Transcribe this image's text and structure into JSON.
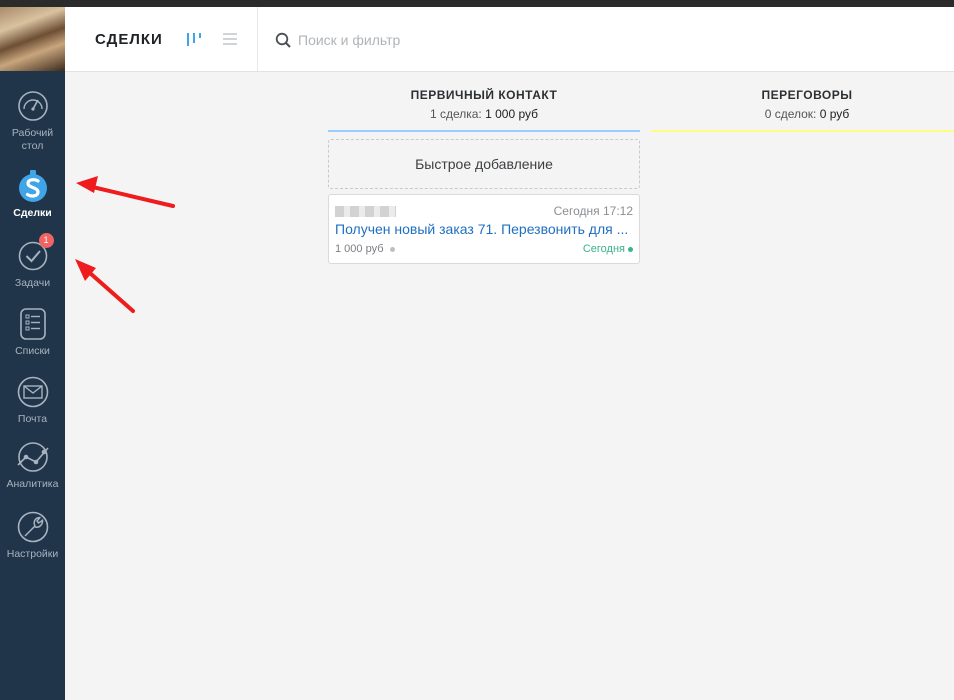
{
  "sidebar": {
    "items": [
      {
        "label": "Рабочий стол",
        "icon": "dashboard-gauge-icon"
      },
      {
        "label": "Сделки",
        "icon": "deals-dollar-icon",
        "active": true
      },
      {
        "label": "Задачи",
        "icon": "tasks-check-icon",
        "badge": "1"
      },
      {
        "label": "Списки",
        "icon": "lists-icon"
      },
      {
        "label": "Почта",
        "icon": "mail-icon"
      },
      {
        "label": "Аналитика",
        "icon": "analytics-icon"
      },
      {
        "label": "Настройки",
        "icon": "settings-wrench-icon"
      }
    ]
  },
  "header": {
    "title": "СДЕЛКИ",
    "search_placeholder": "Поиск и фильтр"
  },
  "pipeline": {
    "columns": [
      {
        "title": "ПЕРВИЧНЫЙ КОНТАКТ",
        "count_text": "1 сделка:",
        "sum_text": "1 000 руб",
        "line_color": "#99ccff"
      },
      {
        "title": "ПЕРЕГОВОРЫ",
        "count_text": "0 сделок:",
        "sum_text": "0 руб",
        "line_color": "#fffd7f"
      }
    ],
    "quick_add_label": "Быстрое добавление",
    "card": {
      "time": "Сегодня 17:12",
      "title": "Получен новый заказ 71. Перезвонить для ...",
      "price": "1 000 руб",
      "due": "Сегодня"
    }
  },
  "colors": {
    "sidebar_bg": "#21354a",
    "accent_blue": "#1f6fc1",
    "badge_red": "#f06463",
    "due_green": "#3bb38b",
    "annotation_arrow": "#ee1c1c"
  }
}
